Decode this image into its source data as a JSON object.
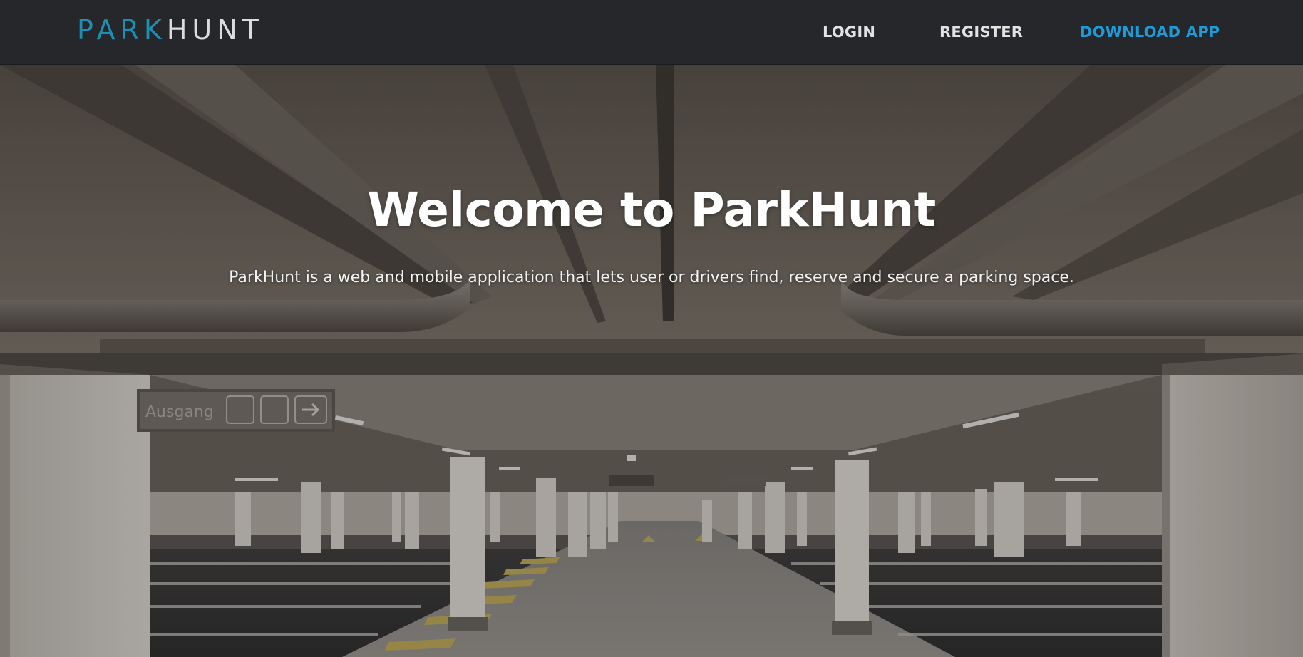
{
  "brand": {
    "part1": "PARK",
    "part2": "HUNT"
  },
  "nav": {
    "login": "LOGIN",
    "register": "REGISTER",
    "download": "DOWNLOAD APP"
  },
  "hero": {
    "title": "Welcome to ParkHunt",
    "subtitle": "ParkHunt is a web and mobile application that lets user or drivers find, reserve and secure a parking space.",
    "sign_text": "Ausgang"
  },
  "colors": {
    "navbar_bg": "#25272b",
    "brand_accent": "#1e8fb4",
    "download_link": "#1e9ad6",
    "nav_text": "#e2e2e2"
  }
}
